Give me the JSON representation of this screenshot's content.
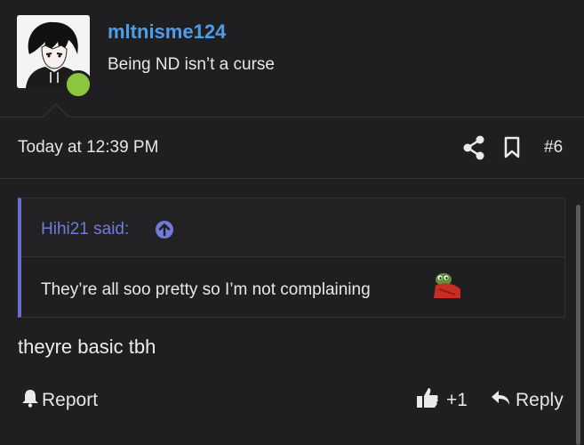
{
  "user": {
    "name": "mltnisme124",
    "title": "Being ND isn’t a curse",
    "online_color": "#8cc63f",
    "name_color": "#4f9de8"
  },
  "post": {
    "timestamp": "Today at 12:39 PM",
    "number": "#6",
    "message": "theyre basic tbh"
  },
  "quote": {
    "author": "Hihi21 said:",
    "text": "They’re all soo pretty so I’m not complaining",
    "accent_color": "#6a6ed0"
  },
  "actions": {
    "report_label": "Report",
    "like_count": "+1",
    "reply_label": "Reply"
  },
  "icons": {
    "share": "share-icon",
    "bookmark": "bookmark-icon",
    "quote_jump": "arrow-up-circle-icon",
    "report": "bell-icon",
    "like": "thumbs-up-icon",
    "reply": "reply-arrow-icon",
    "emoji": "pepe-emoji"
  }
}
